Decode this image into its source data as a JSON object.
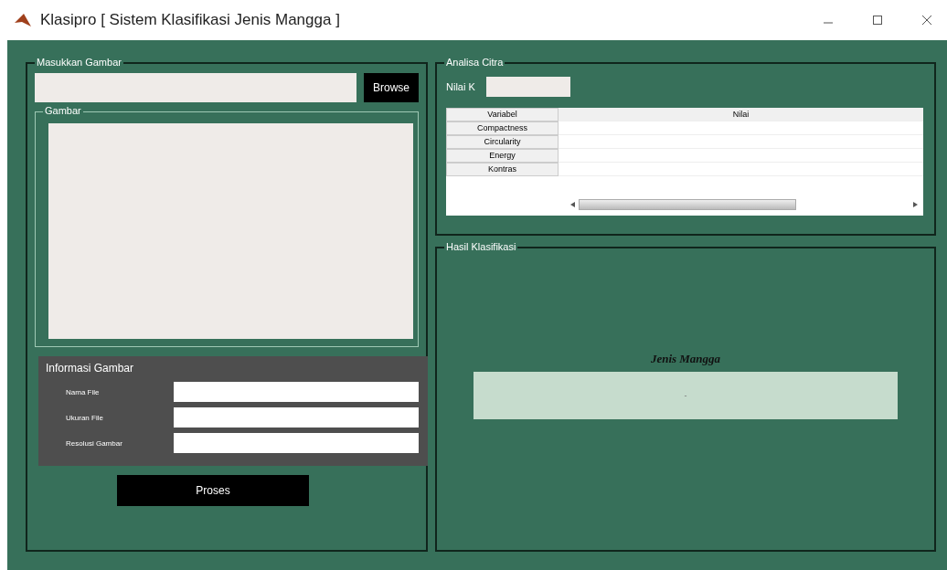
{
  "window": {
    "title": "Klasipro [ Sistem Klasifikasi Jenis Mangga ]"
  },
  "input_panel": {
    "title": "Masukkan Gambar",
    "browse_button": "Browse",
    "image_panel": {
      "title": "Gambar"
    },
    "info": {
      "title": "Informasi Gambar",
      "fields": [
        {
          "label": "Nama File"
        },
        {
          "label": "Ukuran File"
        },
        {
          "label": "Resolusi Gambar"
        }
      ]
    },
    "process_button": "Proses"
  },
  "analysis_panel": {
    "title": "Analisa Citra",
    "k_label": "Nilai K",
    "table": {
      "columns": [
        "Variabel",
        "Nilai"
      ],
      "rows": [
        {
          "variable": "Compactness"
        },
        {
          "variable": "Circularity"
        },
        {
          "variable": "Energy"
        },
        {
          "variable": "Kontras"
        }
      ]
    }
  },
  "result_panel": {
    "title": "Hasil Klasifikasi",
    "label": "Jenis Mangga",
    "value": "-"
  }
}
